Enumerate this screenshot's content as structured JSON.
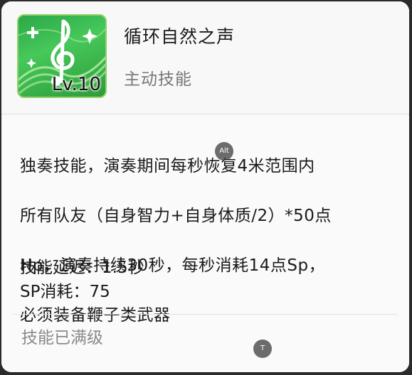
{
  "skill": {
    "name": "循环自然之声",
    "type": "主动技能",
    "level_label": "Lv.10",
    "icon": "treble-clef-icon"
  },
  "description": {
    "lines": [
      "独奏技能，演奏期间每秒恢复4米范围内",
      "所有队友（自身智力+自身体质/2）*50点",
      "Hp，演奏持续30秒，每秒消耗14点Sp，",
      "必须装备鞭子类武器"
    ]
  },
  "stats": {
    "delay": "技能延迟：1.5秒",
    "sp_cost": "SP消耗：75"
  },
  "status": "技能已满级",
  "overlays": {
    "alt": "Alt",
    "t": "T"
  },
  "colors": {
    "icon_green": "#2aa848",
    "text_dark": "#1a1a1a",
    "text_muted": "#8a8a8a"
  }
}
